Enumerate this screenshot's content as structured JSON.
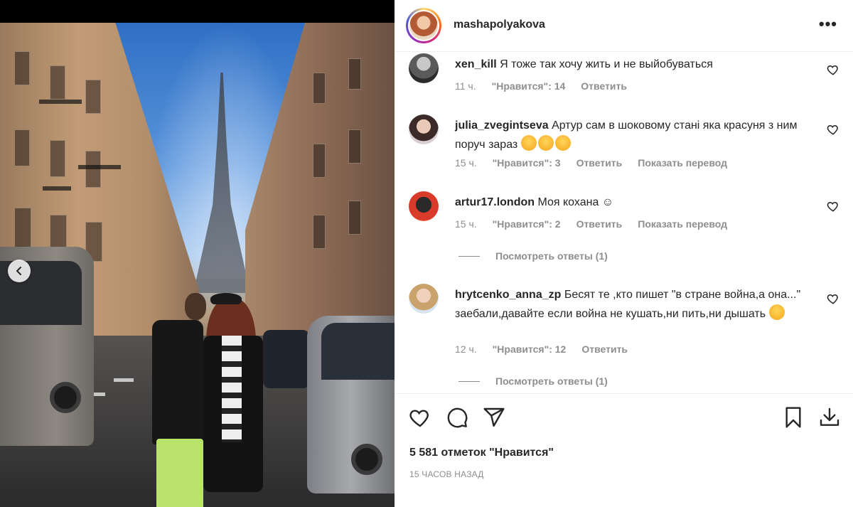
{
  "post": {
    "username": "mashapolyakova",
    "more_glyph": "•••",
    "likes_text": "5 581 отметок \"Нравится\"",
    "time_ago": "15 ЧАСОВ НАЗАД"
  },
  "comments": [
    {
      "username": "xen_kill",
      "text": "Я тоже так хочу жить и не выйобуваться",
      "time": "11 ч.",
      "likes": "\"Нравится\": 14",
      "reply": "Ответить",
      "translate": ""
    },
    {
      "username": "julia_zvegintseva",
      "text": "Артур сам в шоковому стані яка красуня з ним поруч зараз",
      "time": "15 ч.",
      "likes": "\"Нравится\": 3",
      "reply": "Ответить",
      "translate": "Показать перевод"
    },
    {
      "username": "artur17.london",
      "text": "Моя кохана ☺",
      "time": "15 ч.",
      "likes": "\"Нравится\": 2",
      "reply": "Ответить",
      "translate": "Показать перевод"
    },
    {
      "username": "hrytcenko_anna_zp",
      "text": "Бесят те ,кто пишет \"в стране война,а она...\" заебали,давайте если война не кушать,ни пить,ни дышать",
      "time": "12 ч.",
      "likes": "\"Нравится\": 12",
      "reply": "Ответить",
      "translate": ""
    }
  ],
  "view_replies": [
    "Посмотреть ответы (1)",
    "Посмотреть ответы (1)"
  ],
  "icons": {
    "like": "heart-icon",
    "comment": "comment-icon",
    "share": "share-icon",
    "save": "bookmark-icon",
    "download": "download-icon",
    "carousel_prev": "chevron-left-icon"
  },
  "colors": {
    "text": "#262626",
    "muted": "#8e8e8e",
    "border": "#efefef"
  }
}
